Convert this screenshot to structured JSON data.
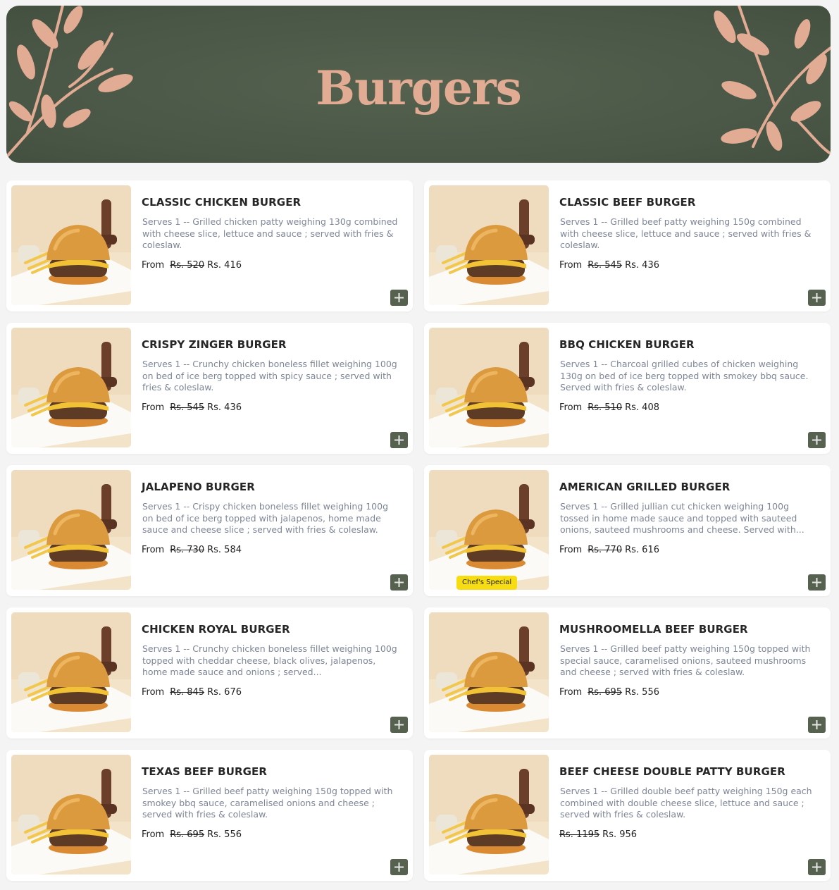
{
  "banner": {
    "title": "Burgers",
    "background_color": "#4d5949",
    "accent_color": "#e2ab93"
  },
  "theme": {
    "add_button_color": "#56614f",
    "badge_color": "#f6dc10"
  },
  "labels": {
    "from": "From",
    "add_icon": "plus-icon"
  },
  "items": [
    {
      "name": "CLASSIC CHICKEN BURGER",
      "description": "Serves 1 -- Grilled chicken patty weighing 130g combined with cheese slice, lettuce and sauce ; served with fries & coleslaw.",
      "from": "From",
      "old_price": "Rs. 520",
      "price": "Rs. 416",
      "badge": ""
    },
    {
      "name": "CLASSIC BEEF BURGER",
      "description": "Serves 1 -- Grilled beef patty weighing 150g combined with cheese slice, lettuce and sauce ; served with fries & coleslaw.",
      "from": "From",
      "old_price": "Rs. 545",
      "price": "Rs. 436",
      "badge": ""
    },
    {
      "name": "CRISPY ZINGER BURGER",
      "description": "Serves 1 -- Crunchy chicken boneless fillet weighing 100g on bed of ice berg topped with spicy sauce ; served with fries & coleslaw.",
      "from": "From",
      "old_price": "Rs. 545",
      "price": "Rs. 436",
      "badge": ""
    },
    {
      "name": "BBQ CHICKEN BURGER",
      "description": "Serves 1 -- Charcoal grilled cubes of chicken weighing 130g on bed of ice berg topped with smokey bbq sauce. Served with fries & coleslaw.",
      "from": "From",
      "old_price": "Rs. 510",
      "price": "Rs. 408",
      "badge": ""
    },
    {
      "name": "JALAPENO BURGER",
      "description": "Serves 1 -- Crispy chicken boneless fillet weighing 100g on bed of ice berg topped with jalapenos, home made sauce and cheese slice ; served with fries & coleslaw.",
      "from": "From",
      "old_price": "Rs. 730",
      "price": "Rs. 584",
      "badge": ""
    },
    {
      "name": "AMERICAN GRILLED BURGER",
      "description": "Serves 1 -- Grilled jullian cut chicken weighing 100g tossed in home made sauce and topped with sauteed onions, sauteed mushrooms and cheese. Served with...",
      "from": "From",
      "old_price": "Rs. 770",
      "price": "Rs. 616",
      "badge": "Chef's Special"
    },
    {
      "name": "CHICKEN ROYAL BURGER",
      "description": "Serves 1 -- Crunchy chicken boneless fillet weighing 100g topped with cheddar cheese, black olives, jalapenos, home made sauce and onions ; served...",
      "from": "From",
      "old_price": "Rs. 845",
      "price": "Rs. 676",
      "badge": ""
    },
    {
      "name": "MUSHROOMELLA BEEF BURGER",
      "description": "Serves 1 -- Grilled beef patty weighing 150g topped with special sauce, caramelised onions, sauteed mushrooms and cheese ; served with fries & coleslaw.",
      "from": "From",
      "old_price": "Rs. 695",
      "price": "Rs. 556",
      "badge": ""
    },
    {
      "name": "TEXAS BEEF BURGER",
      "description": "Serves 1 -- Grilled beef patty weighing 150g topped with smokey bbq sauce, caramelised onions and cheese ; served with fries & coleslaw.",
      "from": "From",
      "old_price": "Rs. 695",
      "price": "Rs. 556",
      "badge": ""
    },
    {
      "name": "BEEF CHEESE DOUBLE PATTY BURGER",
      "description": "Serves 1 -- Grilled double beef patty weighing 150g each combined with double cheese slice, lettuce and sauce ; served with fries & coleslaw.",
      "from": "",
      "old_price": "Rs. 1195",
      "price": "Rs. 956",
      "badge": ""
    }
  ]
}
